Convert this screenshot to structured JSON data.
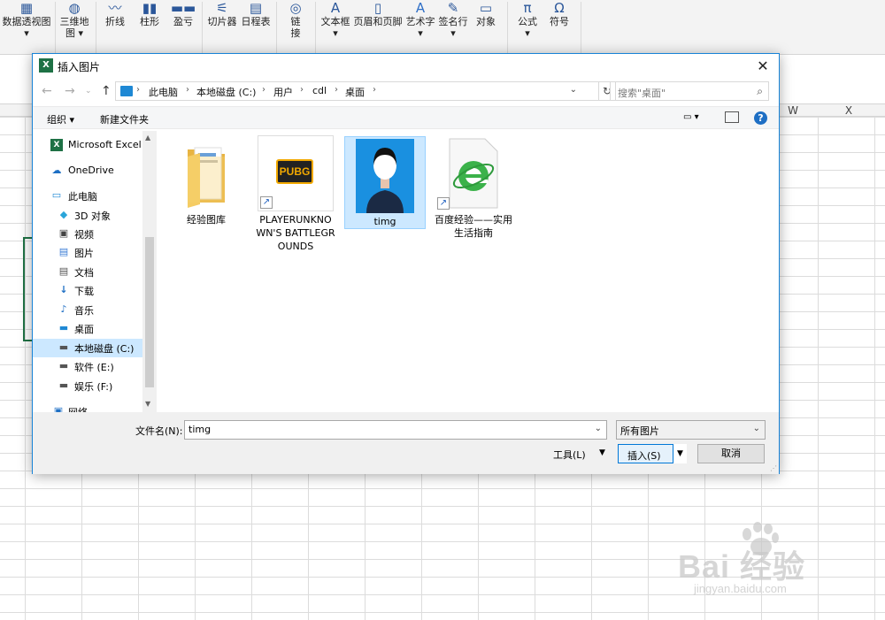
{
  "ribbon": {
    "items": [
      {
        "label": "数据透视图",
        "sub": "▾"
      },
      {
        "label": "三维地",
        "sub": "图 ▾"
      },
      {
        "label": "折线"
      },
      {
        "label": "柱形"
      },
      {
        "label": "盈亏"
      },
      {
        "label": "切片器"
      },
      {
        "label": "日程表"
      },
      {
        "label": "链",
        "sub": "接"
      },
      {
        "label": "文本框",
        "sub": "▾"
      },
      {
        "label": "页眉和页脚"
      },
      {
        "label": "艺术字",
        "sub": "▾"
      },
      {
        "label": "签名行",
        "sub": "▾"
      },
      {
        "label": "对象"
      },
      {
        "label": "公式",
        "sub": "▾"
      },
      {
        "label": "符号"
      }
    ]
  },
  "sheet": {
    "columns": [
      "W",
      "X"
    ]
  },
  "dialog": {
    "title": "插入图片",
    "close": "✕",
    "address": [
      "此电脑",
      "本地磁盘 (C:)",
      "用户",
      "cdl",
      "桌面"
    ],
    "search_placeholder": "搜索\"桌面\"",
    "toolbar": {
      "organize": "组织 ▾",
      "new_folder": "新建文件夹"
    },
    "nav": [
      {
        "label": "Microsoft Excel",
        "icon": "excel-icon"
      },
      {
        "label": "OneDrive",
        "icon": "onedrive-icon"
      },
      {
        "label": "此电脑",
        "icon": "pc-icon"
      },
      {
        "label": "3D 对象",
        "icon": "3d-objects-icon"
      },
      {
        "label": "视频",
        "icon": "video-icon"
      },
      {
        "label": "图片",
        "icon": "pictures-icon"
      },
      {
        "label": "文档",
        "icon": "documents-icon"
      },
      {
        "label": "下载",
        "icon": "download-icon"
      },
      {
        "label": "音乐",
        "icon": "music-icon"
      },
      {
        "label": "桌面",
        "icon": "desktop-icon"
      },
      {
        "label": "本地磁盘 (C:)",
        "icon": "drive-icon",
        "selected": true
      },
      {
        "label": "软件 (E:)",
        "icon": "drive-icon"
      },
      {
        "label": "娱乐 (F:)",
        "icon": "drive-icon"
      },
      {
        "label": "网络",
        "icon": "network-icon"
      }
    ],
    "files": [
      {
        "name": "经验图库",
        "type": "folder"
      },
      {
        "name": "PLAYERUNKNOWN'S BATTLEGROUNDS",
        "type": "shortcut",
        "thumb_text": "PUBG"
      },
      {
        "name": "timg",
        "type": "image",
        "selected": true
      },
      {
        "name": "百度经验——实用生活指南",
        "type": "shortcut"
      }
    ],
    "filename_label": "文件名(N):",
    "filename_value": "timg",
    "filetype_value": "所有图片",
    "tools_label": "工具(L)",
    "insert_label": "插入(S)",
    "cancel_label": "取消"
  },
  "watermark": {
    "brand": "Bai 经验",
    "url": "jingyan.baidu.com"
  },
  "colors": {
    "accent": "#0078d7",
    "excel_green": "#217346",
    "selection": "#cce8ff"
  }
}
